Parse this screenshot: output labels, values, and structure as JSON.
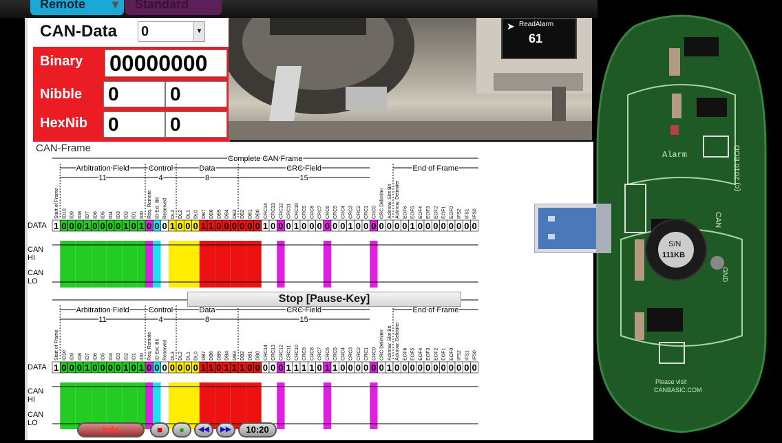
{
  "menu": {
    "tab_remote": "Remote",
    "tab_second": "Standard"
  },
  "can_data": {
    "label": "CAN-Data",
    "selected": "0"
  },
  "readouts": {
    "binary_label": "Binary",
    "binary_value": "00000000",
    "nibble_label": "Nibble",
    "nibble_hi": "0",
    "nibble_lo": "0",
    "hexnib_label": "HexNib",
    "hexnib_hi": "0",
    "hexnib_lo": "0"
  },
  "dashboard": {
    "alarm_title": "ReadAlarm",
    "alarm_value": "61"
  },
  "frame": {
    "title": "CAN-Frame",
    "complete_label": "Complete CAN Frame",
    "sections": [
      {
        "name": "Arbitration Field",
        "count": "11"
      },
      {
        "name": "Control",
        "count": "4"
      },
      {
        "name": "Data",
        "count": "8"
      },
      {
        "name": "CRC Field",
        "count": "15"
      },
      {
        "name": "End of Frame",
        "count": ""
      }
    ],
    "data_row_label": "DATA",
    "can_hi_label": "CAN HI",
    "can_lo_label": "CAN LO",
    "bit_labels": [
      "Start of Frame",
      "ID10",
      "ID9",
      "ID8",
      "ID7",
      "ID6",
      "ID5",
      "ID4",
      "ID3",
      "ID2",
      "ID1",
      "ID0",
      "Req. Remote",
      "ID Ext. Bit",
      "Reserved",
      "DL3",
      "DL2",
      "DL1",
      "DL0",
      "DB7",
      "DB6",
      "DB5",
      "DB4",
      "DB3",
      "DB2",
      "DB1",
      "DB0",
      "CRC14",
      "CRC13",
      "CRC12",
      "CRC11",
      "CRC10",
      "CRC9",
      "CRC8",
      "CRC7",
      "CRC6",
      "CRC5",
      "CRC4",
      "CRC3",
      "CRC2",
      "CRC1",
      "CRC0",
      "CRC Delimiter",
      "Acknow. Slot Bit",
      "Acknow. Delimiter",
      "EOF6",
      "EOF5",
      "EOF4",
      "EOF3",
      "EOF2",
      "EOF1",
      "EOF0",
      "IFS2",
      "IFS1",
      "IFS0"
    ],
    "panel1_bits": "1000100001010001000110000001000100000010000000100000000",
    "panel2_bits": "1000100001010000000110111000001111011000000100000000000",
    "stop_button": "Stop [Pause-Key]"
  },
  "controls": {
    "info": "Info",
    "stop": "■",
    "play": "●",
    "rewind": "◀◀",
    "forward": "▶▶",
    "time": "10:20"
  },
  "board": {
    "alarm_label": "Alarm",
    "sn_label": "S/N",
    "sn_value": "111KB",
    "can_label": "CAN",
    "copyright": "(c) 2010 EOD",
    "gnd_label": "GND",
    "visit_text": "Please visit",
    "website": "CANBASIC.COM"
  },
  "colors": {
    "arbitration": "#22cc22",
    "rtr": "#e020e0",
    "ide": "#20e0f0",
    "control": "#ffee00",
    "data": "#ee1111",
    "crc_stuff": "#e020e0",
    "board_green": "#1f5a26"
  }
}
